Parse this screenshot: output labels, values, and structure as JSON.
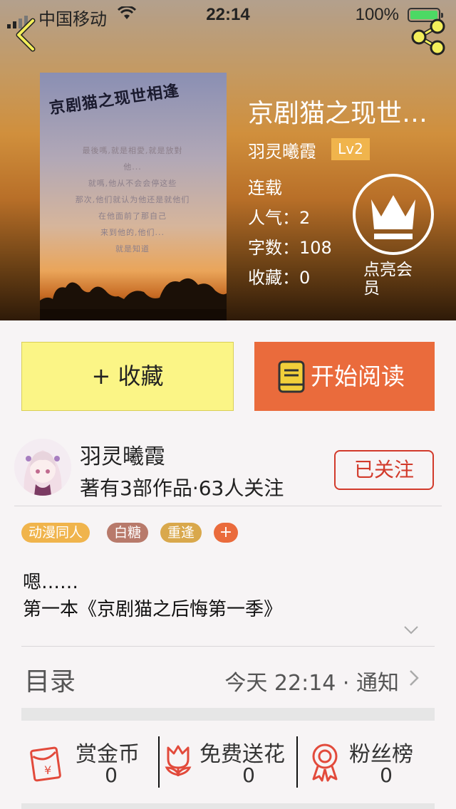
{
  "status_bar": {
    "carrier": "中国移动",
    "time": "22:14",
    "battery": "100%"
  },
  "book": {
    "cover_title": "京剧猫之现世相逢",
    "cover_poem": [
      "最後嗎,就是相愛,就是放對",
      "他...",
      "就嗎,他从不会会停这些",
      "那次,他们就认为他还是就他们",
      "在他面前了那自己",
      "来到他的,他们...",
      "就是知道"
    ],
    "title": "京剧猫之现世…",
    "author": "羽灵曦霞",
    "level": "Lv2",
    "status": "连载",
    "popularity_label": "人气：",
    "popularity": "2",
    "words_label": "字数：",
    "words": "108",
    "favorites_label": "收藏：",
    "favorites": "0",
    "vip_label": "点亮会员"
  },
  "buttons": {
    "collect": "+ 收藏",
    "read": "开始阅读"
  },
  "author_card": {
    "name": "羽灵曦霞",
    "stats": "著有3部作品·63人关注",
    "follow": "已关注"
  },
  "tags": [
    {
      "label": "动漫同人",
      "color": "#f0b44c"
    },
    {
      "label": "白糖",
      "color": "#b87a6b"
    },
    {
      "label": "重逢",
      "color": "#d9a84c"
    }
  ],
  "tag_add": "+",
  "description": [
    "嗯……",
    "第一本《京剧猫之后悔第一季》"
  ],
  "toc": {
    "label": "目录",
    "updated": "今天 22:14 · 通知"
  },
  "actions": [
    {
      "label": "赏金币",
      "value": "0",
      "icon": "red-envelope-icon"
    },
    {
      "label": "免费送花",
      "value": "0",
      "icon": "flower-icon"
    },
    {
      "label": "粉丝榜",
      "value": "0",
      "icon": "medal-icon"
    }
  ],
  "colors": {
    "accent_orange": "#ea6b3c",
    "collect_yellow": "#fbf586",
    "follow_red": "#d23a2b",
    "icon_red": "#e24a3b"
  }
}
